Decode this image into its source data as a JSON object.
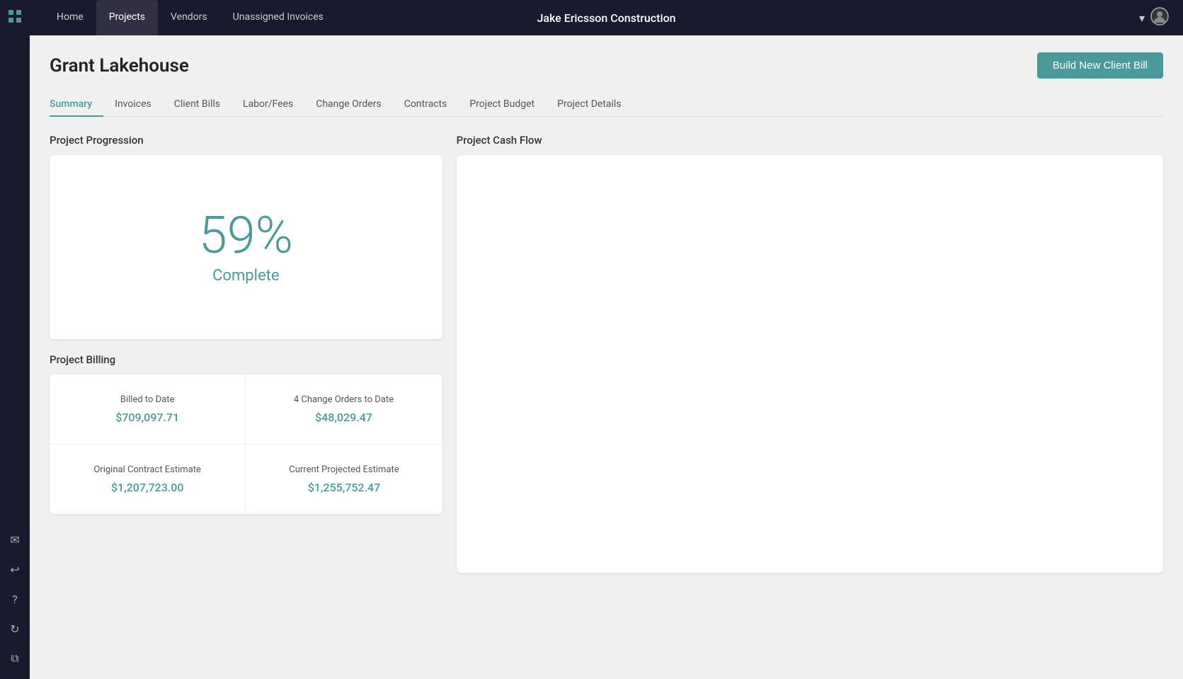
{
  "app": {
    "title": "Jake Ericsson Construction"
  },
  "topnav": {
    "tabs": [
      {
        "id": "home",
        "label": "Home",
        "active": false
      },
      {
        "id": "projects",
        "label": "Projects",
        "active": true
      },
      {
        "id": "vendors",
        "label": "Vendors",
        "active": false
      },
      {
        "id": "unassigned-invoices",
        "label": "Unassigned Invoices",
        "active": false
      }
    ],
    "user_icon": "▾ 👤"
  },
  "page": {
    "title": "Grant Lakehouse",
    "build_button_label": "Build New Client Bill"
  },
  "sub_tabs": [
    {
      "id": "summary",
      "label": "Summary",
      "active": true
    },
    {
      "id": "invoices",
      "label": "Invoices",
      "active": false
    },
    {
      "id": "client-bills",
      "label": "Client Bills",
      "active": false
    },
    {
      "id": "labor-fees",
      "label": "Labor/Fees",
      "active": false
    },
    {
      "id": "change-orders",
      "label": "Change Orders",
      "active": false
    },
    {
      "id": "contracts",
      "label": "Contracts",
      "active": false
    },
    {
      "id": "project-budget",
      "label": "Project Budget",
      "active": false
    },
    {
      "id": "project-details",
      "label": "Project Details",
      "active": false
    }
  ],
  "project_progression": {
    "section_title": "Project Progression",
    "percent": "59%",
    "label": "Complete"
  },
  "project_billing": {
    "section_title": "Project Billing",
    "cells": [
      {
        "label": "Billed to Date",
        "value": "$709,097.71"
      },
      {
        "label": "4 Change Orders to Date",
        "value": "$48,029.47"
      },
      {
        "label": "Original Contract Estimate",
        "value": "$1,207,723.00"
      },
      {
        "label": "Current Projected Estimate",
        "value": "$1,255,752.47"
      }
    ]
  },
  "project_cash_flow": {
    "section_title": "Project Cash Flow"
  },
  "sidebar": {
    "icons": [
      {
        "name": "grid-icon",
        "symbol": "⊞"
      },
      {
        "name": "mail-icon",
        "symbol": "✉"
      },
      {
        "name": "reply-icon",
        "symbol": "↩"
      },
      {
        "name": "question-icon",
        "symbol": "?"
      },
      {
        "name": "refresh-icon",
        "symbol": "↻"
      },
      {
        "name": "layers-icon",
        "symbol": "⧉"
      }
    ]
  }
}
